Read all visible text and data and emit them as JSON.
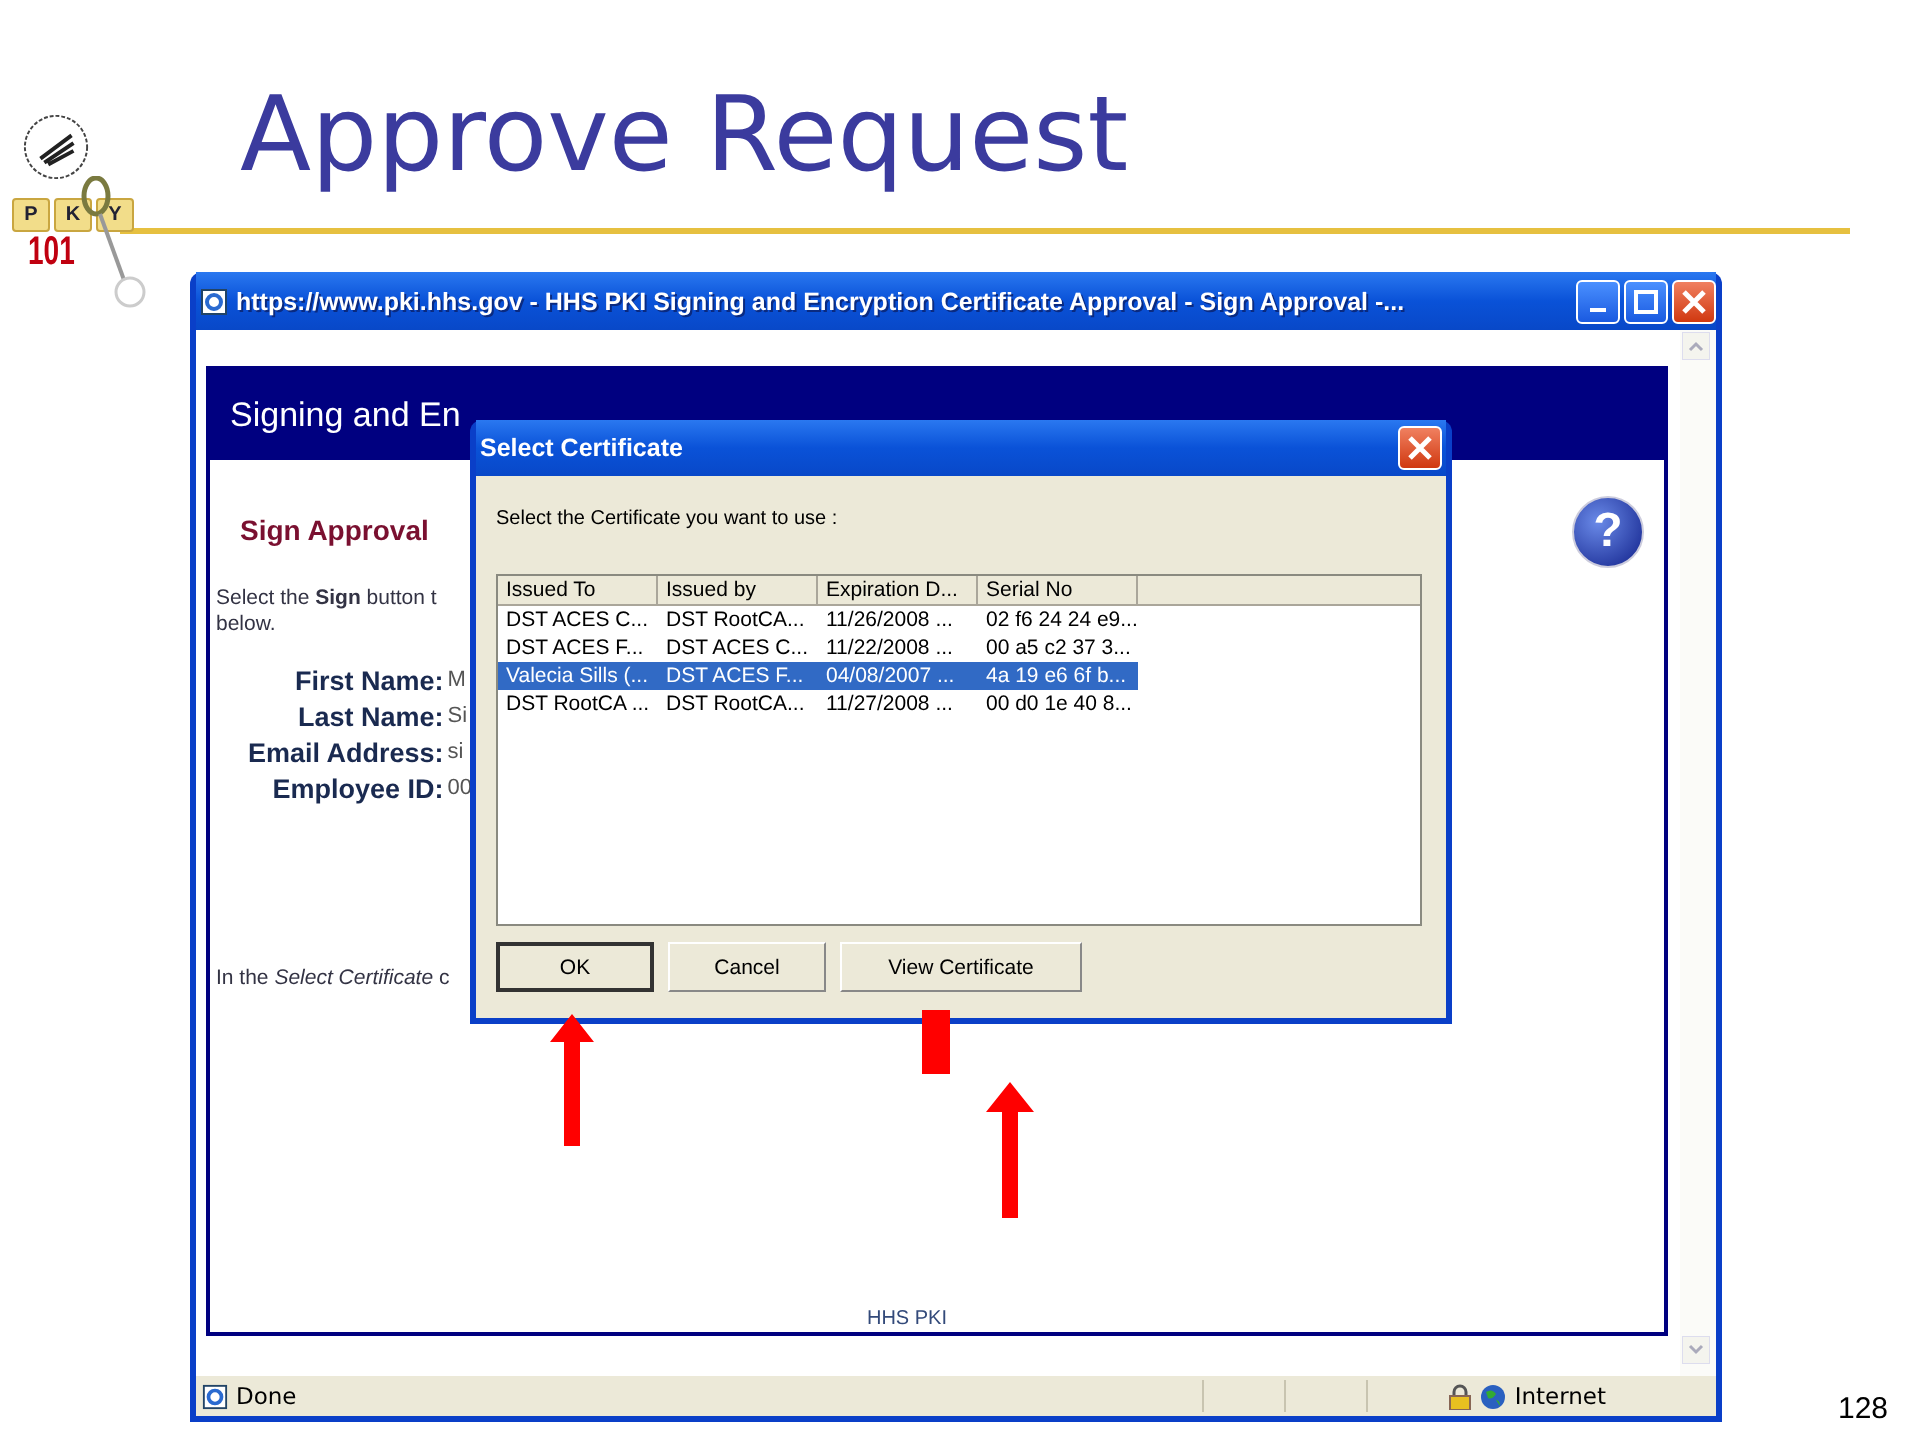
{
  "slide": {
    "title": "Approve Request",
    "page_number": "128",
    "logo": {
      "tiles": [
        "P",
        "K",
        "Y"
      ],
      "number": "101"
    }
  },
  "browser": {
    "title": "https://www.pki.hhs.gov - HHS PKI Signing and Encryption Certificate Approval - Sign Approval -...",
    "page": {
      "banner": "Signing and En",
      "heading": "Sign Approval",
      "instruction_lines": [
        "Select the **Sign** button t",
        "below."
      ],
      "fields": [
        {
          "label": "First Name:",
          "value": "M"
        },
        {
          "label": "Last Name:",
          "value": "Si"
        },
        {
          "label": "Email Address:",
          "value": "si"
        },
        {
          "label": "Employee ID:",
          "value": "00"
        }
      ],
      "note": "In the *Select Certificate* c",
      "help": "?",
      "footer": "HHS PKI"
    },
    "status": {
      "text": "Done",
      "zone": "Internet"
    }
  },
  "dialog": {
    "title": "Select Certificate",
    "prompt": "Select the Certificate you want to use :",
    "columns": [
      "Issued To",
      "Issued by",
      "Expiration D...",
      "Serial No"
    ],
    "rows": [
      {
        "cells": [
          "DST ACES C...",
          "DST RootCA...",
          "11/26/2008  ...",
          "02 f6 24 24 e9..."
        ],
        "selected": false
      },
      {
        "cells": [
          "DST ACES F...",
          "DST ACES C...",
          "11/22/2008  ...",
          "00 a5 c2 37 3..."
        ],
        "selected": false
      },
      {
        "cells": [
          "Valecia Sills (...",
          "DST ACES F...",
          "04/08/2007  ...",
          "4a 19 e6 6f b..."
        ],
        "selected": true
      },
      {
        "cells": [
          "DST RootCA ...",
          "DST RootCA...",
          "11/27/2008  ...",
          "00 d0 1e 40 8..."
        ],
        "selected": false
      }
    ],
    "buttons": [
      {
        "label": "OK",
        "default": true
      },
      {
        "label": "Cancel",
        "default": false
      },
      {
        "label": "View Certificate",
        "default": false
      }
    ]
  }
}
